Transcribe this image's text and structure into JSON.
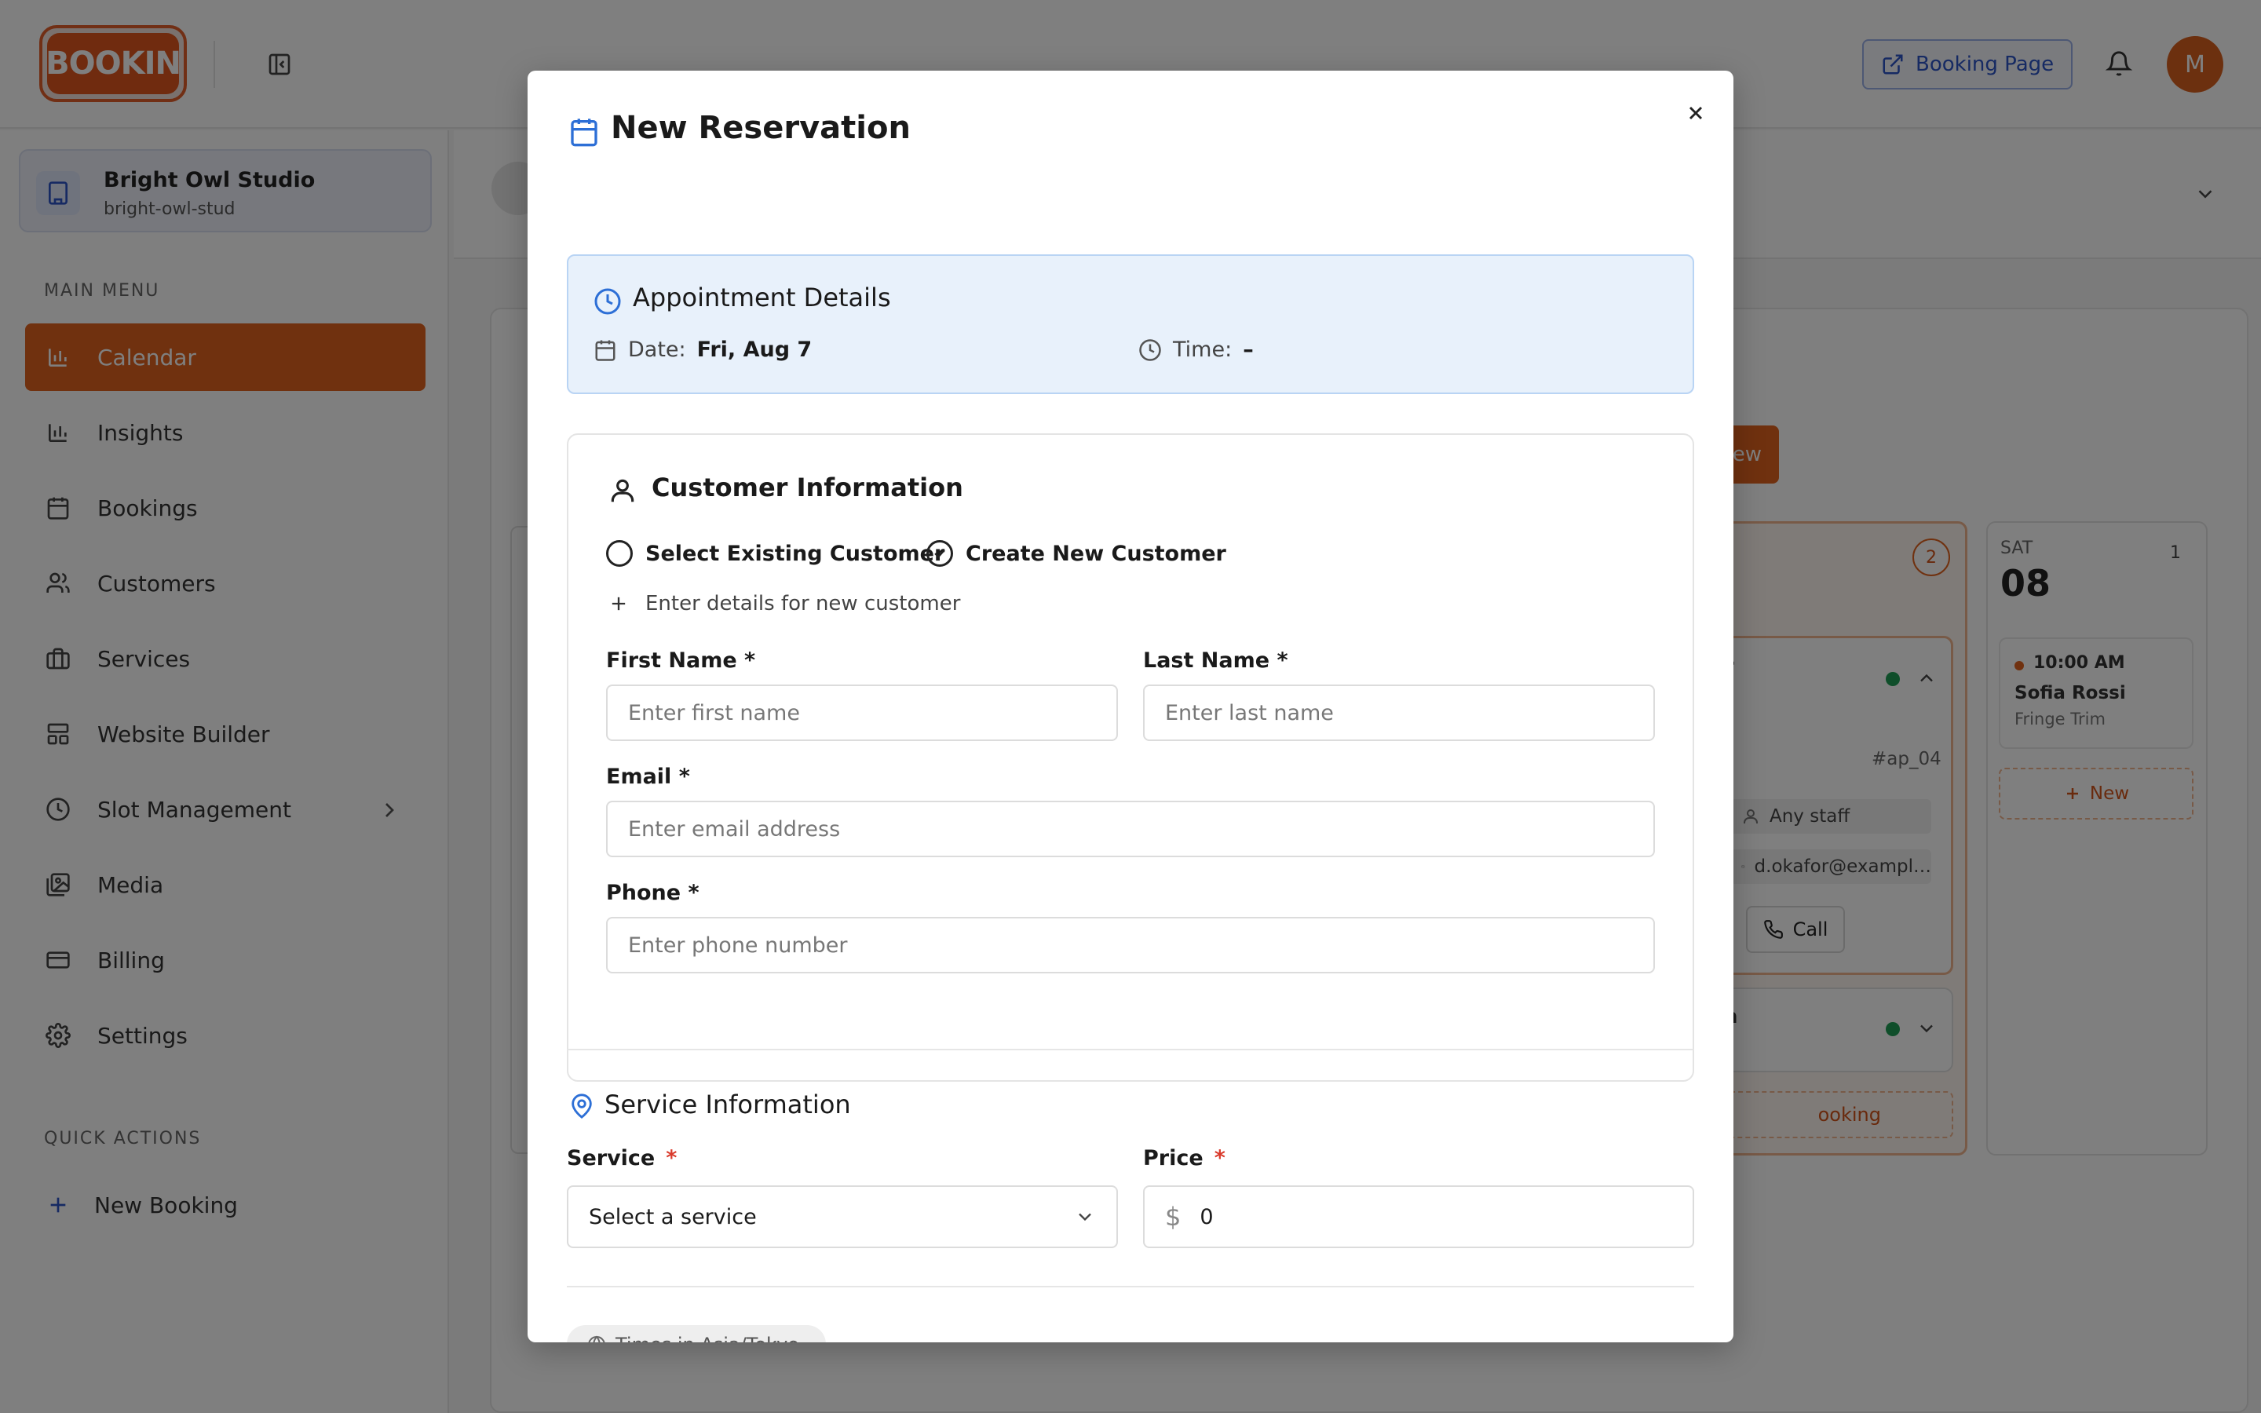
{
  "app": {
    "logo_text": "BOOKIN",
    "booking_page_label": "Booking Page",
    "avatar_initial": "M"
  },
  "sidebar": {
    "studio_name": "Bright Owl Studio",
    "studio_slug": "bright-owl-stud",
    "main_menu_label": "MAIN MENU",
    "items": [
      {
        "label": "Calendar",
        "icon": "bar-chart-icon",
        "active": true
      },
      {
        "label": "Insights",
        "icon": "bar-chart-icon"
      },
      {
        "label": "Bookings",
        "icon": "calendar-icon"
      },
      {
        "label": "Customers",
        "icon": "users-icon"
      },
      {
        "label": "Services",
        "icon": "briefcase-icon"
      },
      {
        "label": "Website Builder",
        "icon": "layout-icon"
      },
      {
        "label": "Slot Management",
        "icon": "clock-icon",
        "has_chevron": true
      },
      {
        "label": "Media",
        "icon": "images-icon"
      },
      {
        "label": "Billing",
        "icon": "credit-card-icon"
      },
      {
        "label": "Settings",
        "icon": "gear-icon"
      }
    ],
    "quick_actions_label": "QUICK ACTIONS",
    "quick_new_booking": "New Booking"
  },
  "calendar_bg": {
    "new_button": "ew",
    "fri_count": "2",
    "fri_card_partial_name": "r",
    "fri_card_id": "#ap_04",
    "fri_staff": "Any staff",
    "fri_email": "d.okafor@exampl…",
    "call_label": "Call",
    "fri_card2_partial": "a",
    "fri_booking_partial": "ooking",
    "sat_dow": "SAT",
    "sat_day": "08",
    "sat_count": "1",
    "sat_event_time": "10:00 AM",
    "sat_event_name": "Sofia Rossi",
    "sat_event_service": "Fringe Trim",
    "sat_new": "New"
  },
  "modal": {
    "title": "New Reservation",
    "appointment": {
      "title": "Appointment Details",
      "date_label": "Date:",
      "date_value": "Fri, Aug 7",
      "time_label": "Time:",
      "time_value": "–"
    },
    "customer": {
      "title": "Customer Information",
      "option_existing": "Select Existing Customer",
      "option_new": "Create New Customer",
      "hint": "Enter details for new customer",
      "first_name_label": "First Name *",
      "first_name_placeholder": "Enter first name",
      "last_name_label": "Last Name *",
      "last_name_placeholder": "Enter last name",
      "email_label": "Email *",
      "email_placeholder": "Enter email address",
      "phone_label": "Phone *",
      "phone_placeholder": "Enter phone number"
    },
    "service": {
      "title": "Service Information",
      "service_label": "Service",
      "service_placeholder": "Select a service",
      "price_label": "Price",
      "required_mark": "*",
      "currency_symbol": "$",
      "price_value": "0"
    },
    "timezone_pill": "Times in Asia/Tokyo"
  },
  "colors": {
    "accent": "#e0631f",
    "link_blue": "#2d55c7",
    "info_bg": "#e8f1fb",
    "required": "#d93a2b"
  }
}
